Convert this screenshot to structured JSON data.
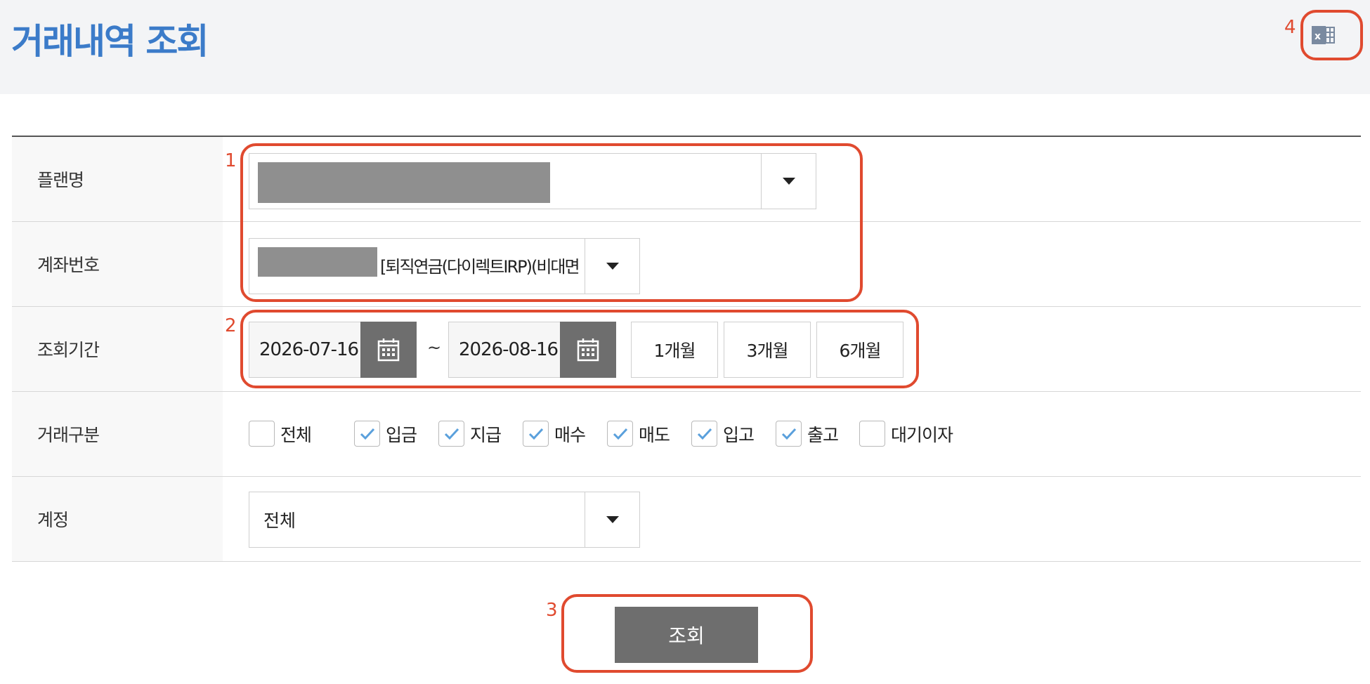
{
  "header": {
    "title": "거래내역 조회",
    "excel_icon": "excel-download-icon"
  },
  "annotations": [
    "1",
    "2",
    "3",
    "4"
  ],
  "form": {
    "plan": {
      "label": "플랜명"
    },
    "account": {
      "label": "계좌번호",
      "value_suffix": "[퇴직연금(다이렉트IRP)(비대면"
    },
    "period": {
      "label": "조회기간",
      "start_date": "2026-07-16",
      "end_date": "2026-08-16",
      "separator": "~",
      "quick_buttons": [
        "1개월",
        "3개월",
        "6개월"
      ]
    },
    "tx_type": {
      "label": "거래구분",
      "options": [
        {
          "label": "전체",
          "checked": false
        },
        {
          "label": "입금",
          "checked": true
        },
        {
          "label": "지급",
          "checked": true
        },
        {
          "label": "매수",
          "checked": true
        },
        {
          "label": "매도",
          "checked": true
        },
        {
          "label": "입고",
          "checked": true
        },
        {
          "label": "출고",
          "checked": true
        },
        {
          "label": "대기이자",
          "checked": false
        }
      ]
    },
    "category": {
      "label": "계정",
      "value": "전체"
    }
  },
  "search_button": "조회",
  "colors": {
    "accent": "#3b7bc9",
    "annotation": "#e04a2f",
    "button": "#6e6e6e",
    "check": "#5aa0dc"
  }
}
